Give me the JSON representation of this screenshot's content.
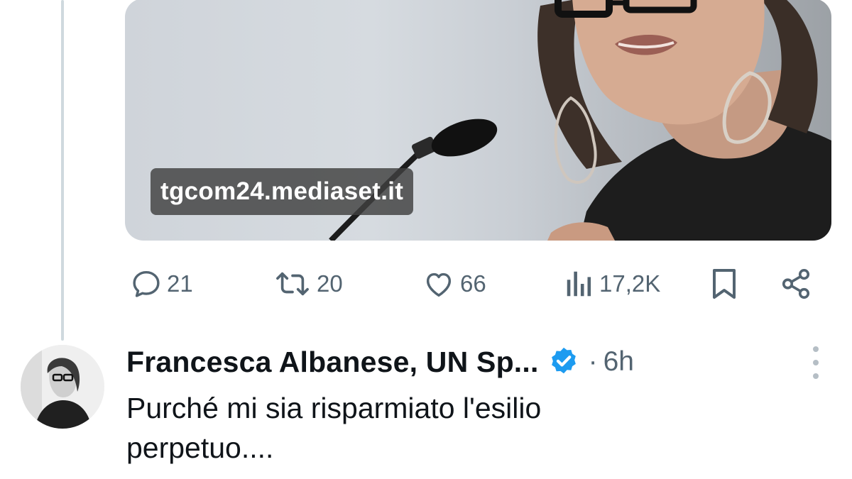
{
  "media": {
    "domain": "tgcom24.mediaset.it"
  },
  "actions": {
    "replies": "21",
    "reposts": "20",
    "likes": "66",
    "views": "17,2K"
  },
  "reply_tweet": {
    "display_name": "Francesca Albanese, UN Sp...",
    "timestamp_separator": "·",
    "timestamp": "6h",
    "text_line1": "Purché mi sia risparmiato l'esilio",
    "text_line2": "perpetuo...."
  },
  "colors": {
    "icon_gray": "#536471",
    "verified_blue": "#1d9bf0",
    "thread_line": "#cfd9de"
  },
  "icons": [
    "reply-icon",
    "repost-icon",
    "like-icon",
    "views-icon",
    "bookmark-icon",
    "share-icon",
    "verified-icon",
    "more-icon"
  ]
}
